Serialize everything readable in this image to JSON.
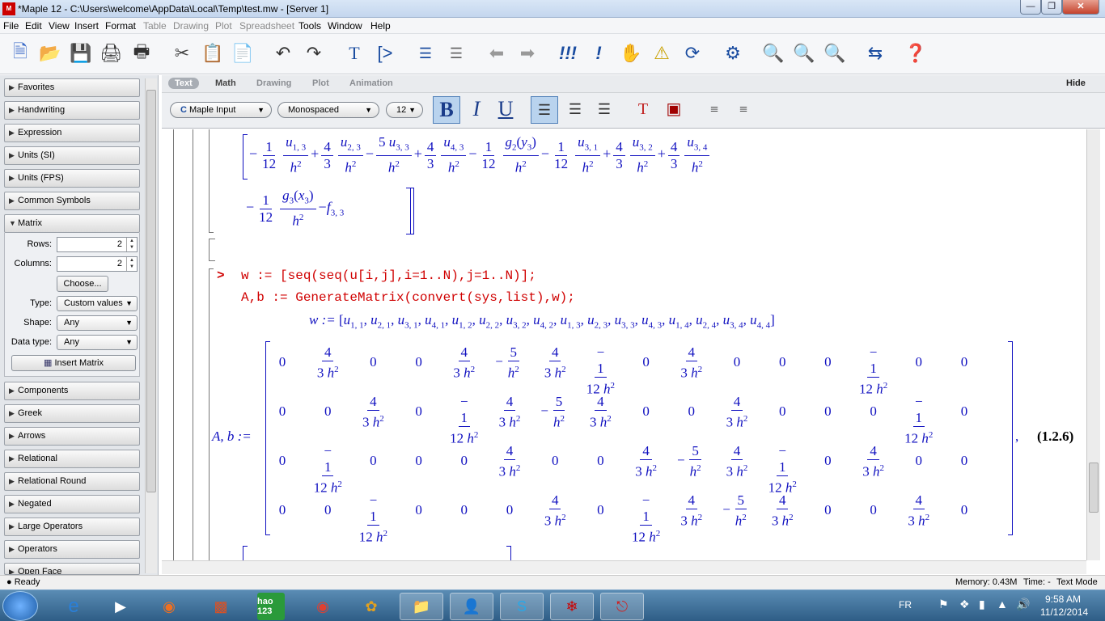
{
  "window": {
    "title": "*Maple 12 - C:\\Users\\welcome\\AppData\\Local\\Temp\\test.mw - [Server 1]",
    "app_icon": "maple-leaf-icon"
  },
  "menu": [
    "File",
    "Edit",
    "View",
    "Insert",
    "Format",
    "Table",
    "Drawing",
    "Plot",
    "Spreadsheet",
    "Tools",
    "Window",
    "Help"
  ],
  "menu_disabled": [
    "Table",
    "Drawing",
    "Plot",
    "Spreadsheet"
  ],
  "palettes": {
    "top": [
      "Favorites",
      "Handwriting",
      "Expression",
      "Units (SI)",
      "Units (FPS)",
      "Common Symbols"
    ],
    "matrix": {
      "title": "Matrix",
      "rows_label": "Rows:",
      "rows": "2",
      "columns_label": "Columns:",
      "columns": "2",
      "choose": "Choose...",
      "type_label": "Type:",
      "type": "Custom values",
      "shape_label": "Shape:",
      "shape": "Any",
      "datatype_label": "Data type:",
      "datatype": "Any",
      "insert": "Insert Matrix"
    },
    "bottom": [
      "Components",
      "Greek",
      "Arrows",
      "Relational",
      "Relational Round",
      "Negated",
      "Large Operators",
      "Operators",
      "Open Face"
    ]
  },
  "context": {
    "tabs": [
      "Text",
      "Math",
      "Drawing",
      "Plot",
      "Animation"
    ],
    "active": "Text",
    "hide": "Hide"
  },
  "format": {
    "mode": "Maple Input",
    "font": "Monospaced",
    "size": "12",
    "bold": "B",
    "italic": "I",
    "underline": "U"
  },
  "document": {
    "cmd_line1": "w := [seq(seq(u[i,j],i=1..N),j=1..N)];",
    "cmd_line2": "A,b := GenerateMatrix(convert(sys,list),w);",
    "prompt": ">",
    "eq_label": "(1.2.6)",
    "lhs": "A, b :=",
    "w_lhs": "w :="
  },
  "status": {
    "left": "Ready",
    "memory": "Memory: 0.43M",
    "time": "Time: -",
    "mode": "Text Mode"
  },
  "taskbar": {
    "lang": "FR",
    "time": "9:58 AM",
    "date": "11/12/2014",
    "hao": "hao 123"
  }
}
